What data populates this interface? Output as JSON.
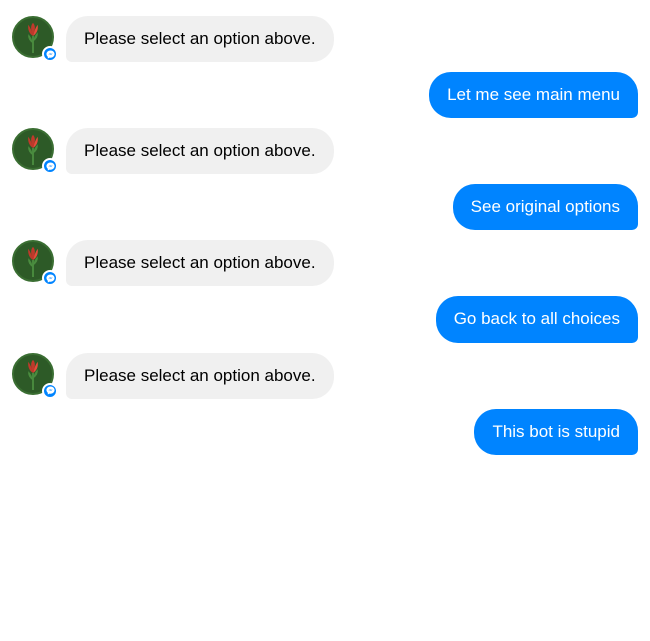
{
  "messages": [
    {
      "id": "bot1",
      "type": "bot",
      "text": "Please select an option above."
    },
    {
      "id": "user1",
      "type": "user",
      "text": "Let me see main menu"
    },
    {
      "id": "bot2",
      "type": "bot",
      "text": "Please select an option above."
    },
    {
      "id": "user2",
      "type": "user",
      "text": "See original options"
    },
    {
      "id": "bot3",
      "type": "bot",
      "text": "Please select an option above."
    },
    {
      "id": "user3",
      "type": "user",
      "text": "Go back to all choices"
    },
    {
      "id": "bot4",
      "type": "bot",
      "text": "Please select an option above."
    },
    {
      "id": "user4",
      "type": "user",
      "text": "This bot is stupid"
    }
  ],
  "colors": {
    "user_bubble": "#0084ff",
    "bot_bubble": "#f0f0f0",
    "messenger_blue": "#0084ff"
  }
}
